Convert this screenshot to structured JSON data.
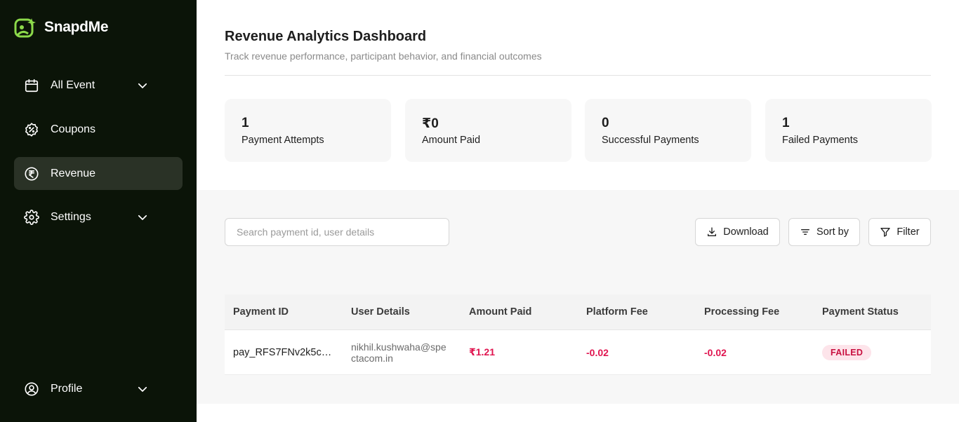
{
  "brand": {
    "name": "SnapdMe",
    "accent": "#8cd94a"
  },
  "sidebar": {
    "items": [
      {
        "label": "All Event",
        "icon": "calendar-icon",
        "has_chevron": true
      },
      {
        "label": "Coupons",
        "icon": "coupon-icon",
        "has_chevron": false
      },
      {
        "label": "Revenue",
        "icon": "rupee-icon",
        "has_chevron": false,
        "active": true
      },
      {
        "label": "Settings",
        "icon": "gear-icon",
        "has_chevron": true
      }
    ],
    "profile": {
      "label": "Profile",
      "icon": "user-icon",
      "has_chevron": true
    }
  },
  "header": {
    "title": "Revenue Analytics Dashboard",
    "subtitle": "Track revenue performance, participant behavior, and financial outcomes"
  },
  "stats": [
    {
      "value": "1",
      "label": "Payment Attempts"
    },
    {
      "value": "₹0",
      "label": "Amount Paid"
    },
    {
      "value": "0",
      "label": "Successful Payments"
    },
    {
      "value": "1",
      "label": "Failed Payments"
    }
  ],
  "toolbar": {
    "search_placeholder": "Search payment id, user details",
    "search_value": "",
    "download_label": "Download",
    "sort_label": "Sort by",
    "filter_label": "Filter"
  },
  "table": {
    "columns": [
      "Payment ID",
      "User Details",
      "Amount Paid",
      "Platform Fee",
      "Processing Fee",
      "Payment Status"
    ],
    "rows": [
      {
        "payment_id": "pay_RFS7FNv2k5cg…",
        "user": "nikhil.kushwaha@spectacom.in",
        "amount": "₹1.21",
        "platform_fee": "-0.02",
        "processing_fee": "-0.02",
        "status": "FAILED"
      }
    ]
  },
  "colors": {
    "sidebar_bg": "#0b1408",
    "negative": "#e0144f",
    "failed_badge_bg": "#fde4ea"
  }
}
